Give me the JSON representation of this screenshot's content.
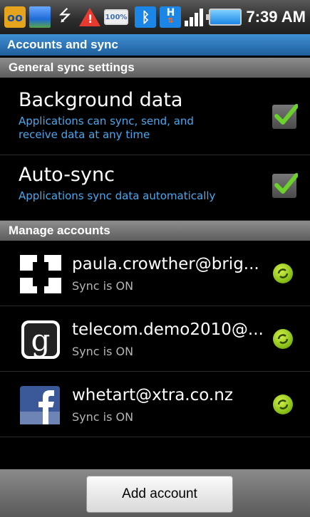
{
  "status_bar": {
    "battery_small_text": "100%",
    "time": "7:39 AM",
    "icons": [
      "voicemail-icon",
      "picture-icon",
      "usb-icon",
      "warning-icon",
      "battery-small-icon",
      "bluetooth-icon",
      "hspa-icon",
      "signal-icon",
      "battery-icon"
    ]
  },
  "title": "Accounts and sync",
  "general": {
    "header": "General sync settings",
    "settings": [
      {
        "title": "Background data",
        "desc_line1": "Applications can sync, send, and",
        "desc_line2": "receive data at any time",
        "checked": true
      },
      {
        "title": "Auto-sync",
        "desc_line1": "Applications sync data automatically",
        "checked": true
      }
    ]
  },
  "manage": {
    "header": "Manage accounts",
    "accounts": [
      {
        "name": "paula.crowther@brig...",
        "status": "Sync is ON",
        "logo": "exchange-icon"
      },
      {
        "name": "telecom.demo2010@...",
        "status": "Sync is ON",
        "logo": "google-icon"
      },
      {
        "name": "whetart@xtra.co.nz",
        "status": "Sync is ON",
        "logo": "facebook-icon"
      }
    ]
  },
  "add_account_label": "Add account",
  "colors": {
    "accent_blue": "#4aa8ef",
    "check_green": "#6bd12b",
    "sync_green": "#8cc21a"
  }
}
